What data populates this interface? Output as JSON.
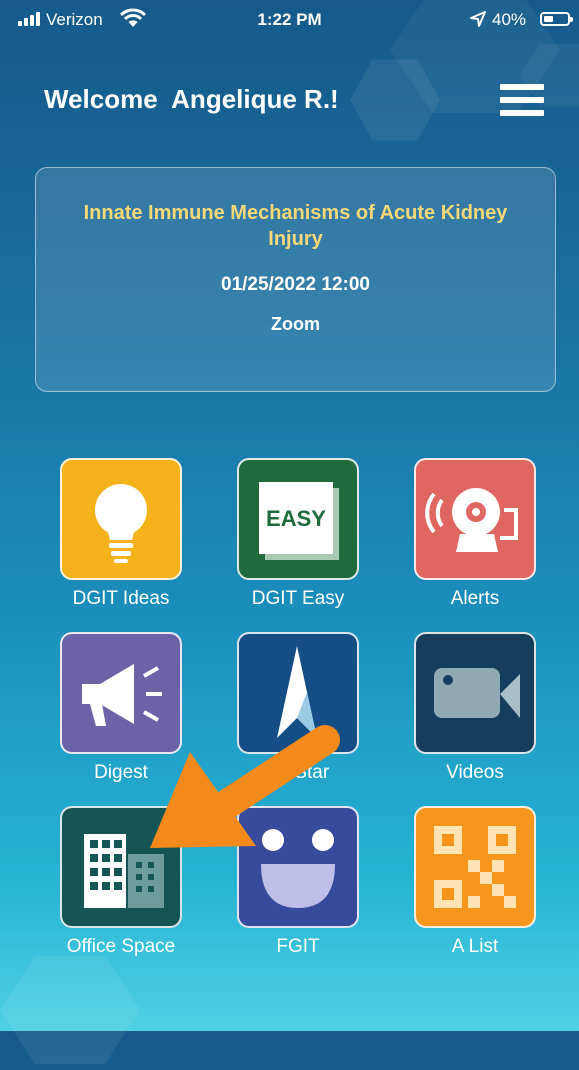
{
  "status_bar": {
    "carrier": "Verizon",
    "time": "1:22 PM",
    "battery_percent": "40%",
    "icons": [
      "signal-bars-icon",
      "wifi-icon",
      "location-arrow-icon",
      "battery-icon"
    ]
  },
  "header": {
    "welcome": "Welcome  Angelique R.!",
    "menu_icon": "hamburger-menu-icon"
  },
  "event_card": {
    "title": "Innate Immune Mechanisms of Acute Kidney Injury",
    "datetime": "01/25/2022 12:00",
    "location": "Zoom"
  },
  "tiles": [
    {
      "label": "DGIT Ideas",
      "icon": "lightbulb-icon",
      "color": "#f6b21b"
    },
    {
      "label": "DGIT Easy",
      "icon": "easy-button-icon",
      "color": "#1f6b3e",
      "icon_text": "EASY"
    },
    {
      "label": "Alerts",
      "icon": "alarm-bell-icon",
      "color": "#e06661"
    },
    {
      "label": "Digest",
      "icon": "megaphone-icon",
      "color": "#6a63a8"
    },
    {
      "label": "rth Star",
      "icon": "north-star-icon",
      "color": "#154d86"
    },
    {
      "label": "Videos",
      "icon": "video-camera-icon",
      "color": "#173d5d"
    },
    {
      "label": "Office Space",
      "icon": "office-building-icon",
      "color": "#155556"
    },
    {
      "label": "FGIT",
      "icon": "smiley-face-icon",
      "color": "#384a9c"
    },
    {
      "label": "A List",
      "icon": "qr-code-icon",
      "color": "#f7961c"
    }
  ],
  "annotation": {
    "type": "pointer-arrow",
    "color": "#f48a1c"
  }
}
